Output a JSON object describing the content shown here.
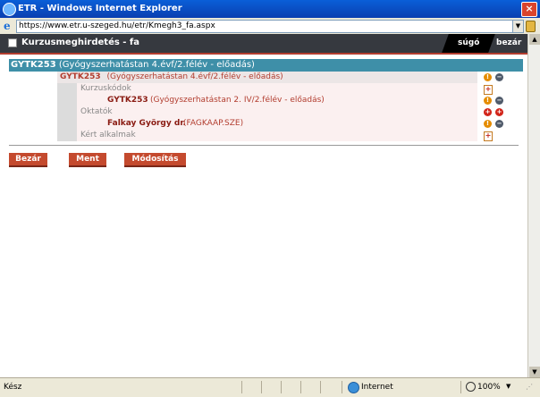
{
  "window": {
    "title": "ETR - Windows Internet Explorer",
    "close_symbol": "×"
  },
  "address_bar": {
    "url": "https://www.etr.u-szeged.hu/etr/Kmegh3_fa.aspx",
    "dropdown_symbol": "▼",
    "e_logo": "e"
  },
  "header": {
    "title": "Kurzusmeghirdetés - fa",
    "help_label": "súgó",
    "close_label": "bezár"
  },
  "course": {
    "code": "GYTK253",
    "name": "(Gyógyszerhatástan 4.évf/2.félév - előadás)"
  },
  "tree": {
    "course_code": "GYTK253",
    "course_name": "(Gyógyszerhatástan 4.évf/2.félév - előadás)",
    "course_codes_label": "Kurzuskódok",
    "linked_course_code": "GYTK253",
    "linked_course_name": "(Gyógyszerhatástan 2. IV/2.félév - előadás)",
    "instructors_label": "Oktatók",
    "instructor_name": "Falkay György dr.",
    "instructor_code": "(FAGKAAP.SZE)",
    "requested_times_label": "Kért alkalmak"
  },
  "icons": {
    "info": "!",
    "minus": "−",
    "plus": "+",
    "add": "+"
  },
  "buttons": {
    "close": "Bezár",
    "save": "Ment",
    "modify": "Módosítás"
  },
  "scrollbar": {
    "up": "▲",
    "down": "▼"
  },
  "status_bar": {
    "status": "Kész",
    "zone": "Internet",
    "zoom": "100%",
    "zoom_dropdown": "▼",
    "grip": "⋰"
  }
}
